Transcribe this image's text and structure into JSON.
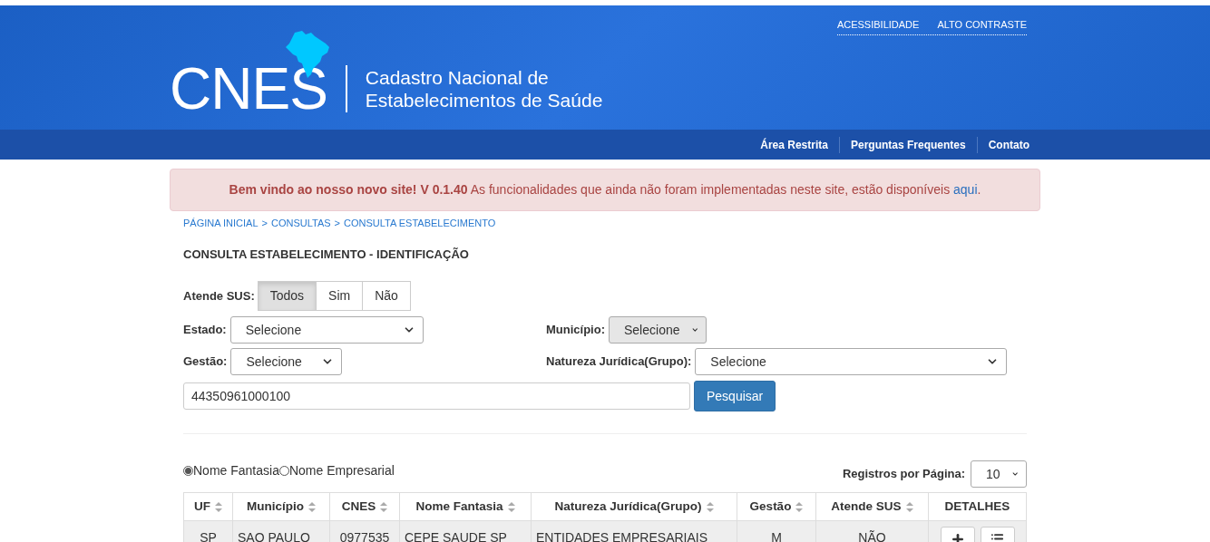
{
  "top_links": [
    {
      "label": "ACESSIBILIDADE"
    },
    {
      "label": "ALTO CONTRASTE"
    }
  ],
  "logo": {
    "acronym": "CNES",
    "subtitle_lines": [
      "Cadastro Nacional de",
      "Estabelecimentos de Saúde"
    ]
  },
  "nav": [
    {
      "label": "Área Restrita"
    },
    {
      "label": "Perguntas Frequentes"
    },
    {
      "label": "Contato"
    }
  ],
  "alert": {
    "text": "**Bem vindo ao nosso novo site! V 0.1.40** As funcionalidades que ainda não foram implementadas neste site, estão disponíveis ",
    "link": "aqui",
    "after": "."
  },
  "breadcrumb": {
    "separator": ">",
    "items": [
      "PÁGINA INICIAL",
      "CONSULTAS",
      "CONSULTA ESTABELECIMENTO"
    ]
  },
  "page_title": "CONSULTA ESTABELECIMENTO - IDENTIFICAÇÃO",
  "atende_sus": {
    "label": "Atende SUS:",
    "options": [
      {
        "label": "Todos",
        "selected": true
      },
      {
        "label": "Sim",
        "selected": false
      },
      {
        "label": "Não",
        "selected": false
      }
    ]
  },
  "filters": [
    {
      "label": "Estado:",
      "value": "Selecione",
      "disabled": false
    },
    {
      "label": "Município:",
      "value": "Selecione",
      "disabled": true
    },
    {
      "label": "Gestão:",
      "value": "Selecione",
      "disabled": false
    },
    {
      "label": "Natureza Jurídica(Grupo):",
      "value": "Selecione",
      "disabled": false
    }
  ],
  "search": {
    "value": "44350961000100",
    "button": "Pesquisar"
  },
  "name_type": [
    {
      "label": "Nome Fantasia",
      "selected": true
    },
    {
      "label": "Nome Empresarial",
      "selected": false
    }
  ],
  "page_size": {
    "label": "Registros por Página:",
    "value": "10"
  },
  "table": {
    "columns": [
      {
        "label": "UF",
        "sortable": true
      },
      {
        "label": "Município",
        "sortable": true
      },
      {
        "label": "CNES",
        "sortable": true
      },
      {
        "label": "Nome Fantasia",
        "sortable": true
      },
      {
        "label": "Natureza Jurídica(Grupo)",
        "sortable": true
      },
      {
        "label": "Gestão",
        "sortable": true
      },
      {
        "label": "Atende SUS",
        "sortable": true
      },
      {
        "label": "DETALHES",
        "sortable": false
      }
    ],
    "rows": [
      {
        "cells": [
          "SP",
          "SAO PAULO",
          "0977535",
          "CEPE SAUDE SP",
          "ENTIDADES EMPRESARIAIS",
          "M",
          "NÃO"
        ]
      }
    ]
  }
}
